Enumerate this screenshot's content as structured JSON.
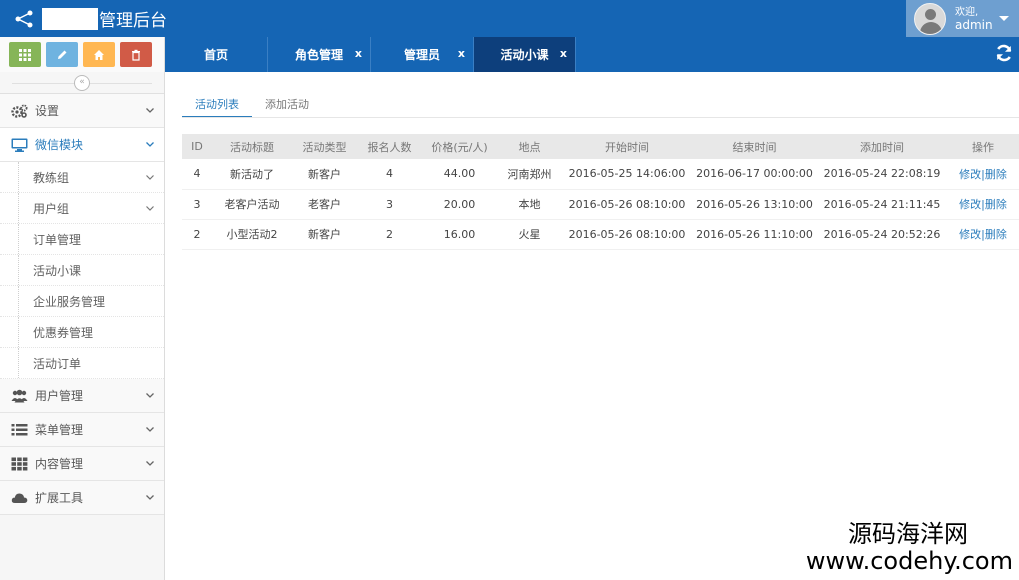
{
  "header": {
    "title": "管理后台",
    "user_welcome": "欢迎,",
    "user_name": "admin"
  },
  "sidebar": {
    "shortcuts": [
      "grid-icon",
      "pencil-icon",
      "home-icon",
      "trash-icon"
    ],
    "menu": [
      {
        "label": "设置",
        "icon": "cogs-icon"
      },
      {
        "label": "微信模块",
        "icon": "desktop-icon",
        "active": true
      },
      {
        "label": "用户管理",
        "icon": "users-icon"
      },
      {
        "label": "菜单管理",
        "icon": "list-icon"
      },
      {
        "label": "内容管理",
        "icon": "th-icon"
      },
      {
        "label": "扩展工具",
        "icon": "cloud-icon"
      }
    ],
    "submenu": [
      {
        "label": "教练组",
        "has_children": true
      },
      {
        "label": "用户组",
        "has_children": true
      },
      {
        "label": "订单管理"
      },
      {
        "label": "活动小课"
      },
      {
        "label": "企业服务管理"
      },
      {
        "label": "优惠券管理"
      },
      {
        "label": "活动订单"
      }
    ]
  },
  "tabs": [
    {
      "label": "首页",
      "closable": false
    },
    {
      "label": "角色管理",
      "closable": true
    },
    {
      "label": "管理员",
      "closable": true
    },
    {
      "label": "活动小课",
      "closable": true,
      "active": true
    }
  ],
  "tab_close_glyph": "x",
  "subtabs": [
    "活动列表",
    "添加活动"
  ],
  "table": {
    "columns": [
      "ID",
      "活动标题",
      "活动类型",
      "报名人数",
      "价格(元/人)",
      "地点",
      "开始时间",
      "结束时间",
      "添加时间",
      "操作"
    ],
    "rows": [
      [
        "4",
        "新活动了",
        "新客户",
        "4",
        "44.00",
        "河南郑州",
        "2016-05-25 14:06:00",
        "2016-06-17 00:00:00",
        "2016-05-24 22:08:19"
      ],
      [
        "3",
        "老客户活动",
        "老客户",
        "3",
        "20.00",
        "本地",
        "2016-05-26 08:10:00",
        "2016-05-26 13:10:00",
        "2016-05-24 21:11:45"
      ],
      [
        "2",
        "小型活动2",
        "新客户",
        "2",
        "16.00",
        "火星",
        "2016-05-26 08:10:00",
        "2016-05-26 11:10:00",
        "2016-05-24 20:52:26"
      ]
    ],
    "action_edit": "修改|",
    "action_delete": "删除"
  },
  "watermark": {
    "cn": "源码海洋网",
    "en": "www.codehy.com"
  },
  "colors": {
    "navbar": "#1565b4",
    "active_tab": "#0d3f7c",
    "link": "#2b7dbc"
  }
}
